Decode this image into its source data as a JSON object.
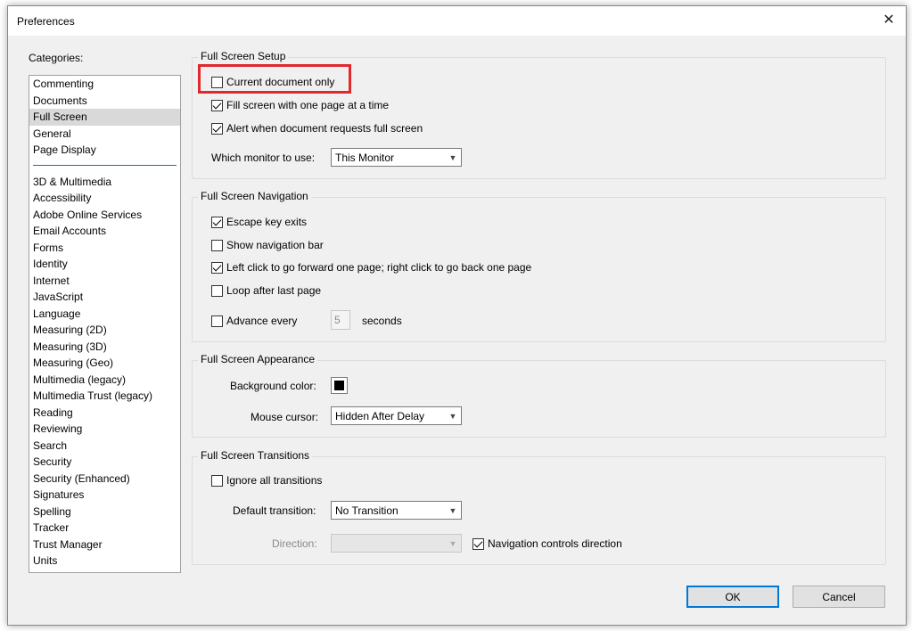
{
  "window": {
    "title": "Preferences"
  },
  "categories": {
    "label": "Categories:",
    "group1": [
      "Commenting",
      "Documents",
      "Full Screen",
      "General",
      "Page Display"
    ],
    "group2": [
      "3D & Multimedia",
      "Accessibility",
      "Adobe Online Services",
      "Email Accounts",
      "Forms",
      "Identity",
      "Internet",
      "JavaScript",
      "Language",
      "Measuring (2D)",
      "Measuring (3D)",
      "Measuring (Geo)",
      "Multimedia (legacy)",
      "Multimedia Trust (legacy)",
      "Reading",
      "Reviewing",
      "Search",
      "Security",
      "Security (Enhanced)",
      "Signatures",
      "Spelling",
      "Tracker",
      "Trust Manager",
      "Units"
    ],
    "selected": "Full Screen"
  },
  "setup": {
    "title": "Full Screen Setup",
    "current_doc_only": {
      "label": "Current document only",
      "checked": false
    },
    "fill_one_page": {
      "label": "Fill screen with one page at a time",
      "checked": true
    },
    "alert_request": {
      "label": "Alert when document requests full screen",
      "checked": true
    },
    "monitor_label": "Which monitor to use:",
    "monitor_value": "This Monitor"
  },
  "navigation": {
    "title": "Full Screen Navigation",
    "escape_exits": {
      "label": "Escape key exits",
      "checked": true
    },
    "show_nav_bar": {
      "label": "Show navigation bar",
      "checked": false
    },
    "left_click": {
      "label": "Left click to go forward one page; right click to go back one page",
      "checked": true
    },
    "loop": {
      "label": "Loop after last page",
      "checked": false
    },
    "advance": {
      "label": "Advance every",
      "checked": false
    },
    "advance_value": "5",
    "seconds_label": "seconds"
  },
  "appearance": {
    "title": "Full Screen Appearance",
    "bg_label": "Background color:",
    "bg_color": "#000000",
    "cursor_label": "Mouse cursor:",
    "cursor_value": "Hidden After Delay"
  },
  "transitions": {
    "title": "Full Screen Transitions",
    "ignore": {
      "label": "Ignore all transitions",
      "checked": false
    },
    "default_label": "Default transition:",
    "default_value": "No Transition",
    "direction_label": "Direction:",
    "direction_value": "",
    "nav_direction": {
      "label": "Navigation controls direction",
      "checked": true
    }
  },
  "buttons": {
    "ok": "OK",
    "cancel": "Cancel"
  },
  "colors": {
    "highlight": "#e0282d",
    "accent": "#0078d7"
  }
}
